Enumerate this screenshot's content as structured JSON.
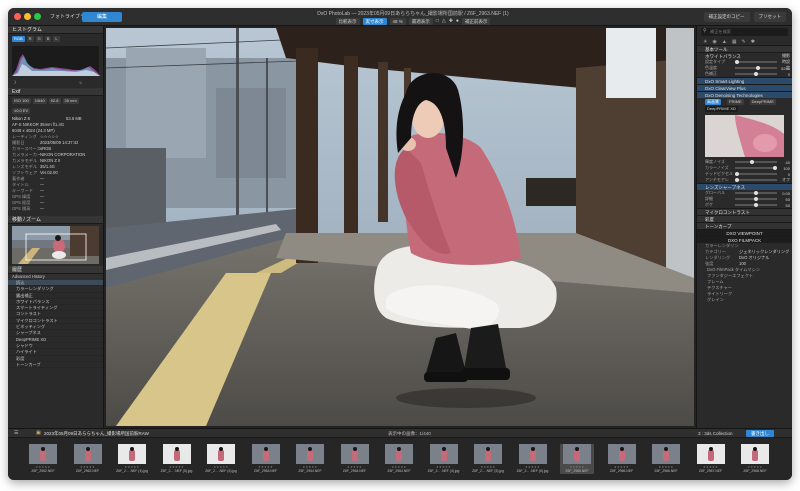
{
  "window": {
    "title": "DxO PhotoLab — 2023年05月09日あららちゃん_撮影場所国前駅 / Z6F_2963.NEF (1)",
    "tabs": [
      "フォトライブラリ",
      "編集"
    ],
    "toolbar": [
      "比較表示",
      "実寸表示",
      "48 %",
      "最適表示",
      "補正前表示"
    ],
    "right_buttons": [
      "補正設定のコピー",
      "プリセット"
    ]
  },
  "left": {
    "histogram_title": "ヒストグラム",
    "histogram_chips": [
      "RGB",
      "R",
      "G",
      "B",
      "L"
    ],
    "exif_title": "Exif",
    "exif_chips": [
      "ISO 100",
      "1/640",
      "f/2.8",
      "35 mm",
      "±0.0 EV"
    ],
    "file_name": "Nikon Z 6",
    "file_size": "53.6 MB",
    "file_rows": [
      "AF-S NIKKOR 35mm f/1.4G",
      "6048 x 4024 (24.3 MP)"
    ],
    "meta": [
      {
        "k": "レーティング",
        "v": "☆☆☆☆☆"
      },
      {
        "k": "撮影日",
        "v": "2023/05/09 14:37:42"
      },
      {
        "k": "カラースペース",
        "v": "sRGB"
      },
      {
        "k": "カメラメーカー",
        "v": "NIKON CORPORATION"
      },
      {
        "k": "カメラモデル",
        "v": "NIKON Z 6"
      },
      {
        "k": "レンズモデル",
        "v": "35/1.4G"
      },
      {
        "k": "ソフトウェア",
        "v": "Ver.02.00"
      },
      {
        "k": "著作者",
        "v": "—"
      },
      {
        "k": "タイトル",
        "v": "—"
      },
      {
        "k": "キーワード",
        "v": "—"
      },
      {
        "k": "GPS 緯度",
        "v": "—"
      },
      {
        "k": "GPS 経度",
        "v": "—"
      },
      {
        "k": "GPS 標高",
        "v": "—"
      }
    ],
    "navigator_title": "移動 / ズーム",
    "history_title": "履歴",
    "history_subtitle": "Advanced History",
    "history_items": [
      "読込",
      "カラーレンダリング",
      "露出補正",
      "ホワイトバランス",
      "スマートライティング",
      "コントラスト",
      "マイクロコントラスト",
      "ビネッティング",
      "シャープネス",
      "DeepPRIME XD",
      "シャドウ",
      "ハイライト",
      "彩度",
      "トーンカーブ"
    ]
  },
  "right": {
    "search_placeholder": "補正を検索",
    "basic_title": "基本ツール",
    "wb_title": "ホワイトバランス",
    "wb_rows": [
      {
        "lab": "設定タイプ",
        "val": "撮影時設定",
        "pos": 0.0
      },
      {
        "lab": "色温度",
        "val": "5240",
        "pos": 0.55
      },
      {
        "lab": "色補正",
        "val": "0",
        "pos": 0.5
      }
    ],
    "smart_lighting": "DxO Smart Lighting",
    "clearview": "DxO ClearView Plus",
    "denoise_title": "DxO Denoising Technologies",
    "denoise_options": [
      "高画質",
      "PRIME",
      "DeepPRIME",
      "DeepPRIME XD"
    ],
    "denoise_rows": [
      {
        "lab": "輝度ノイズ",
        "val": "40",
        "pos": 0.4
      },
      {
        "lab": "カラーノイズ",
        "val": "100",
        "pos": 1.0
      },
      {
        "lab": "デッドピクセル",
        "val": "0",
        "pos": 0.0
      },
      {
        "lab": "アンチモアレ",
        "val": "オフ",
        "pos": 0.0
      }
    ],
    "sharp_title": "レンズシャープネス",
    "sharp_rows": [
      {
        "lab": "グローバル",
        "val": "0.00",
        "pos": 0.5
      },
      {
        "lab": "詳細",
        "val": "50",
        "pos": 0.5
      },
      {
        "lab": "ボケ",
        "val": "50",
        "pos": 0.5
      }
    ],
    "extra_rows": [
      "マイクロコントラスト",
      "彩度",
      "トーンカーブ"
    ],
    "viewpoint": "DXO VIEWPOINT",
    "filmpack": "DXO FILMPACK",
    "filmpack_rows": [
      {
        "lab": "カラーレンダリング",
        "val": ""
      },
      {
        "lab": "カテゴリー",
        "val": "ジェネリックレンダリング"
      },
      {
        "lab": "レンダリング",
        "val": "DxO オリジナル"
      },
      {
        "lab": "強度",
        "val": "100"
      }
    ],
    "filmpack_tail": [
      "DxO FilmPack タイムマシン",
      "ファンタジーエフェクト",
      "フレーム",
      "テクスチャー",
      "ライトリーク",
      "グレイン"
    ]
  },
  "filmstrip": {
    "folder": "2023年05月09日あららちゃん_撮影場所国前駅RAW",
    "count": "表示中の画像：1/440",
    "collection": "3 : 3ds Collection",
    "export_button": "書き出し",
    "items": [
      {
        "name": "Z6F_2962.NEF"
      },
      {
        "name": "Z6F_2962.NEF"
      },
      {
        "name": "Z6F_2... .NEF (4).jpg"
      },
      {
        "name": "Z6F_2... .NEF (5).jpg"
      },
      {
        "name": "Z6F_2... .NEF (6).jpg"
      },
      {
        "name": "Z6F_2963.NEF"
      },
      {
        "name": "Z6F_2964.NEF"
      },
      {
        "name": "Z6F_2964.NEF"
      },
      {
        "name": "Z6F_2964.NEF"
      },
      {
        "name": "Z6F_2... .NEF (4).jpg"
      },
      {
        "name": "Z6F_2... .NEF (5).jpg"
      },
      {
        "name": "Z6F_2... .NEF (6).jpg"
      },
      {
        "name": "Z6F_2965.NEF"
      },
      {
        "name": "Z6F_2966.NEF"
      },
      {
        "name": "Z6F_2966.NEF"
      },
      {
        "name": "Z6F_2967.NEF"
      },
      {
        "name": "Z6F_2968.NEF"
      }
    ]
  },
  "colors": {
    "accent": "#2f86d1",
    "panel": "#2a2a2a",
    "window": "#232323"
  }
}
